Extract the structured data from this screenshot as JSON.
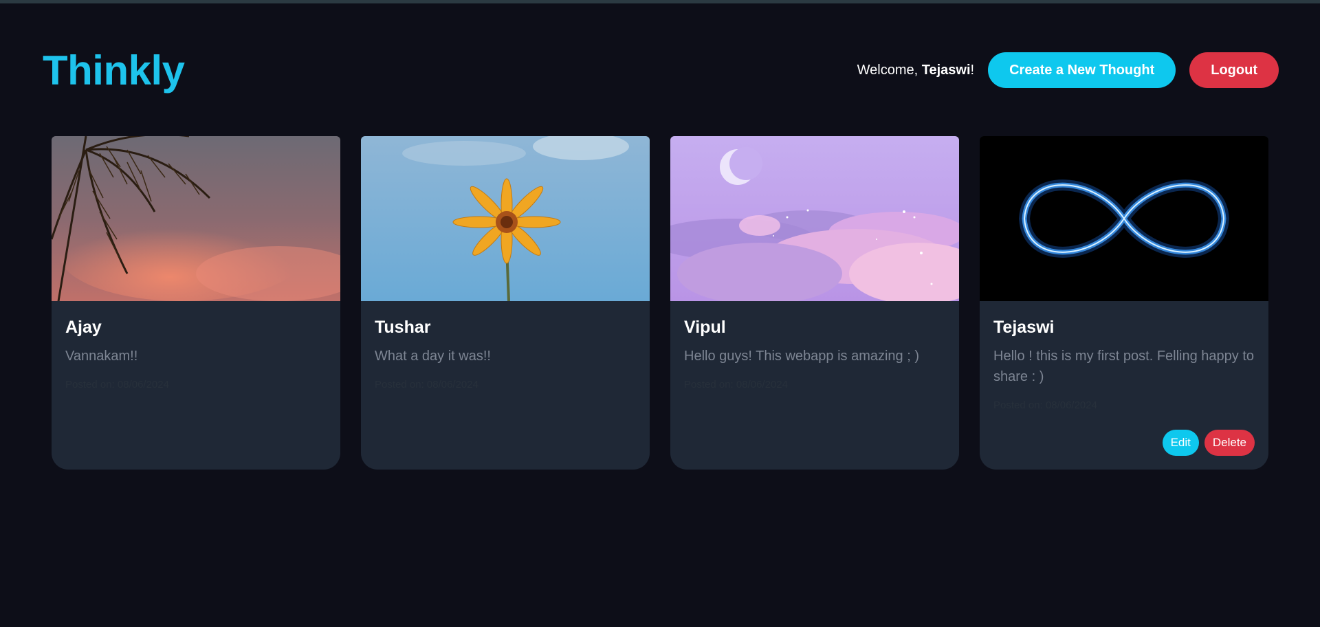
{
  "header": {
    "logo": "Thinkly",
    "welcome_prefix": "Welcome, ",
    "username": "Tejaswi",
    "welcome_suffix": "!",
    "create_label": "Create a New Thought",
    "logout_label": "Logout"
  },
  "posts": [
    {
      "author": "Ajay",
      "text": "Vannakam!!",
      "date": "Posted on: 08/06/2024",
      "image": "palm-tree-sunset-image"
    },
    {
      "author": "Tushar",
      "text": "What a day it was!!",
      "date": "Posted on: 08/06/2024",
      "image": "yellow-flower-sky-image"
    },
    {
      "author": "Vipul",
      "text": "Hello guys! This webapp is amazing ; )",
      "date": "Posted on: 08/06/2024",
      "image": "purple-clouds-moon-image"
    },
    {
      "author": "Tejaswi",
      "text": "Hello ! this is my first post. Felling happy to share : )",
      "date": "Posted on: 08/06/2024",
      "image": "blue-infinity-image",
      "edit_label": "Edit",
      "delete_label": "Delete"
    }
  ],
  "colors": {
    "background": "#0d0e18",
    "accent": "#0ec8ee",
    "danger": "#dd3344",
    "card": "#1f2836"
  }
}
